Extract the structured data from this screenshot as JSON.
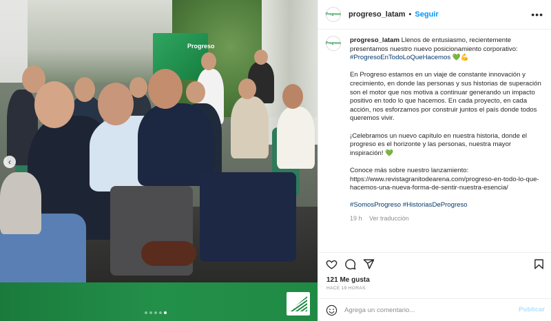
{
  "post": {
    "username": "progreso_latam",
    "follow_label": "Seguir",
    "separator": "•",
    "avatar_text": "Progreso",
    "caption": {
      "username": "progreso_latam",
      "intro": "Llenos de entusiasmo, recientemente presentamos nuestro nuevo posicionamiento corporativo:",
      "intro_tag": "#ProgresoEnTodoLoQueHacemos",
      "intro_emojis": "💚💪",
      "paragraph_2": "En Progreso estamos en un viaje de constante innovación y crecimiento, en donde las personas y sus historias de superación son el motor que nos motiva a continuar generando un impacto positivo en todo lo que hacemos. En cada proyecto, en cada acción, nos esforzamos por construir juntos el país donde todos queremos vivir.",
      "paragraph_3": "¡Celebramos un nuevo capítulo en nuestra historia, donde el progreso es el horizonte y las personas, nuestra mayor inspiración!",
      "paragraph_3_emoji": "💚",
      "paragraph_4": "Conoce más sobre nuestro lanzamiento: https://www.revistagranitodearena.com/progreso-en-todo-lo-que-hacemos-una-nueva-forma-de-sentir-nuestra-esencia/",
      "tags": "#SomosProgreso #HistoriasDeProgreso",
      "age": "19 h",
      "see_translation": "Ver traducción"
    },
    "likes": "121 Me gusta",
    "time": "HACE 19 HORAS",
    "comment_placeholder": "Agrega un comentario...",
    "publish_label": "Publicar"
  },
  "image": {
    "screen_text": "Progreso",
    "carousel_dots": 5,
    "active_dot": 4
  },
  "icons": {
    "more": "more-options-icon",
    "like": "heart-icon",
    "comment": "comment-icon",
    "share": "share-icon",
    "save": "bookmark-icon",
    "emoji": "emoji-icon",
    "prev": "chevron-left-icon"
  },
  "colors": {
    "accent": "#0095f6",
    "brand_green": "#1f8a44",
    "hashtag": "#00376b",
    "muted": "#8e8e8e"
  }
}
